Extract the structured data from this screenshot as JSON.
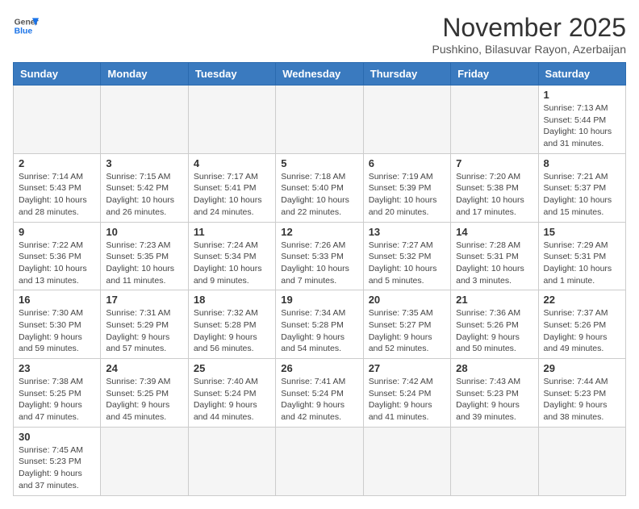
{
  "logo": {
    "general": "General",
    "blue": "Blue"
  },
  "title": "November 2025",
  "location": "Pushkino, Bilasuvar Rayon, Azerbaijan",
  "weekdays": [
    "Sunday",
    "Monday",
    "Tuesday",
    "Wednesday",
    "Thursday",
    "Friday",
    "Saturday"
  ],
  "weeks": [
    [
      {
        "day": "",
        "info": ""
      },
      {
        "day": "",
        "info": ""
      },
      {
        "day": "",
        "info": ""
      },
      {
        "day": "",
        "info": ""
      },
      {
        "day": "",
        "info": ""
      },
      {
        "day": "",
        "info": ""
      },
      {
        "day": "1",
        "info": "Sunrise: 7:13 AM\nSunset: 5:44 PM\nDaylight: 10 hours and 31 minutes."
      }
    ],
    [
      {
        "day": "2",
        "info": "Sunrise: 7:14 AM\nSunset: 5:43 PM\nDaylight: 10 hours and 28 minutes."
      },
      {
        "day": "3",
        "info": "Sunrise: 7:15 AM\nSunset: 5:42 PM\nDaylight: 10 hours and 26 minutes."
      },
      {
        "day": "4",
        "info": "Sunrise: 7:17 AM\nSunset: 5:41 PM\nDaylight: 10 hours and 24 minutes."
      },
      {
        "day": "5",
        "info": "Sunrise: 7:18 AM\nSunset: 5:40 PM\nDaylight: 10 hours and 22 minutes."
      },
      {
        "day": "6",
        "info": "Sunrise: 7:19 AM\nSunset: 5:39 PM\nDaylight: 10 hours and 20 minutes."
      },
      {
        "day": "7",
        "info": "Sunrise: 7:20 AM\nSunset: 5:38 PM\nDaylight: 10 hours and 17 minutes."
      },
      {
        "day": "8",
        "info": "Sunrise: 7:21 AM\nSunset: 5:37 PM\nDaylight: 10 hours and 15 minutes."
      }
    ],
    [
      {
        "day": "9",
        "info": "Sunrise: 7:22 AM\nSunset: 5:36 PM\nDaylight: 10 hours and 13 minutes."
      },
      {
        "day": "10",
        "info": "Sunrise: 7:23 AM\nSunset: 5:35 PM\nDaylight: 10 hours and 11 minutes."
      },
      {
        "day": "11",
        "info": "Sunrise: 7:24 AM\nSunset: 5:34 PM\nDaylight: 10 hours and 9 minutes."
      },
      {
        "day": "12",
        "info": "Sunrise: 7:26 AM\nSunset: 5:33 PM\nDaylight: 10 hours and 7 minutes."
      },
      {
        "day": "13",
        "info": "Sunrise: 7:27 AM\nSunset: 5:32 PM\nDaylight: 10 hours and 5 minutes."
      },
      {
        "day": "14",
        "info": "Sunrise: 7:28 AM\nSunset: 5:31 PM\nDaylight: 10 hours and 3 minutes."
      },
      {
        "day": "15",
        "info": "Sunrise: 7:29 AM\nSunset: 5:31 PM\nDaylight: 10 hours and 1 minute."
      }
    ],
    [
      {
        "day": "16",
        "info": "Sunrise: 7:30 AM\nSunset: 5:30 PM\nDaylight: 9 hours and 59 minutes."
      },
      {
        "day": "17",
        "info": "Sunrise: 7:31 AM\nSunset: 5:29 PM\nDaylight: 9 hours and 57 minutes."
      },
      {
        "day": "18",
        "info": "Sunrise: 7:32 AM\nSunset: 5:28 PM\nDaylight: 9 hours and 56 minutes."
      },
      {
        "day": "19",
        "info": "Sunrise: 7:34 AM\nSunset: 5:28 PM\nDaylight: 9 hours and 54 minutes."
      },
      {
        "day": "20",
        "info": "Sunrise: 7:35 AM\nSunset: 5:27 PM\nDaylight: 9 hours and 52 minutes."
      },
      {
        "day": "21",
        "info": "Sunrise: 7:36 AM\nSunset: 5:26 PM\nDaylight: 9 hours and 50 minutes."
      },
      {
        "day": "22",
        "info": "Sunrise: 7:37 AM\nSunset: 5:26 PM\nDaylight: 9 hours and 49 minutes."
      }
    ],
    [
      {
        "day": "23",
        "info": "Sunrise: 7:38 AM\nSunset: 5:25 PM\nDaylight: 9 hours and 47 minutes."
      },
      {
        "day": "24",
        "info": "Sunrise: 7:39 AM\nSunset: 5:25 PM\nDaylight: 9 hours and 45 minutes."
      },
      {
        "day": "25",
        "info": "Sunrise: 7:40 AM\nSunset: 5:24 PM\nDaylight: 9 hours and 44 minutes."
      },
      {
        "day": "26",
        "info": "Sunrise: 7:41 AM\nSunset: 5:24 PM\nDaylight: 9 hours and 42 minutes."
      },
      {
        "day": "27",
        "info": "Sunrise: 7:42 AM\nSunset: 5:24 PM\nDaylight: 9 hours and 41 minutes."
      },
      {
        "day": "28",
        "info": "Sunrise: 7:43 AM\nSunset: 5:23 PM\nDaylight: 9 hours and 39 minutes."
      },
      {
        "day": "29",
        "info": "Sunrise: 7:44 AM\nSunset: 5:23 PM\nDaylight: 9 hours and 38 minutes."
      }
    ],
    [
      {
        "day": "30",
        "info": "Sunrise: 7:45 AM\nSunset: 5:23 PM\nDaylight: 9 hours and 37 minutes."
      },
      {
        "day": "",
        "info": ""
      },
      {
        "day": "",
        "info": ""
      },
      {
        "day": "",
        "info": ""
      },
      {
        "day": "",
        "info": ""
      },
      {
        "day": "",
        "info": ""
      },
      {
        "day": "",
        "info": ""
      }
    ]
  ]
}
